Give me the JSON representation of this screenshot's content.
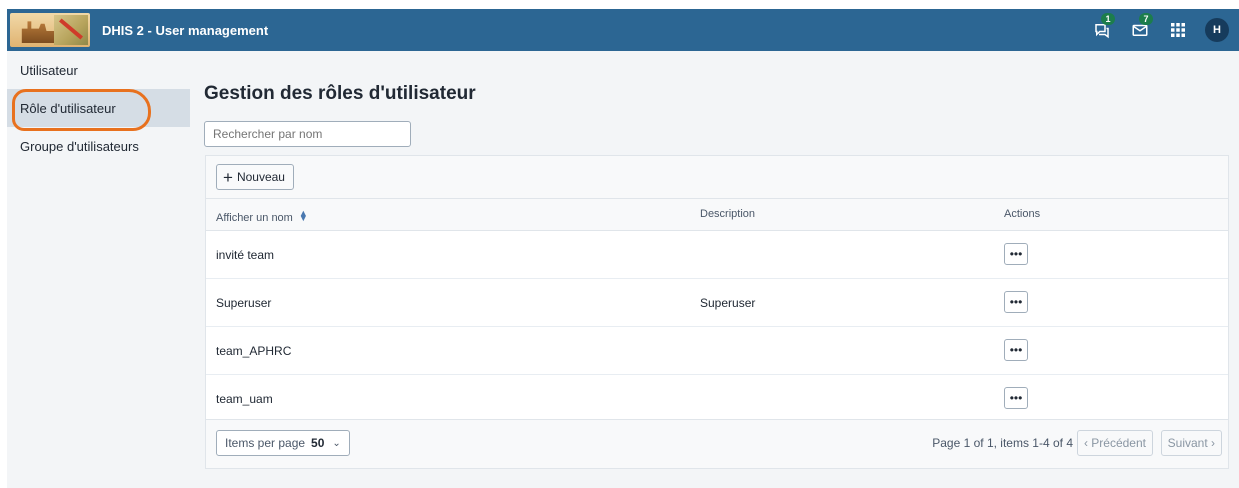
{
  "app": {
    "title": "DHIS 2 - User management"
  },
  "header": {
    "icons": [
      {
        "name": "interpretations-icon",
        "badge": "1"
      },
      {
        "name": "messages-icon",
        "badge": "7"
      },
      {
        "name": "apps-grid-icon"
      }
    ],
    "avatar_initial": "H"
  },
  "sidebar": {
    "items": [
      {
        "label": "Utilisateur",
        "active": false
      },
      {
        "label": "Rôle d'utilisateur",
        "active": true
      },
      {
        "label": "Groupe d'utilisateurs",
        "active": false
      }
    ]
  },
  "main": {
    "title": "Gestion des rôles d'utilisateur",
    "search_placeholder": "Rechercher par nom",
    "new_button": "Nouveau",
    "columns": [
      "Afficher un nom",
      "Description",
      "Actions"
    ],
    "rows": [
      {
        "name": "invité team",
        "description": ""
      },
      {
        "name": "Superuser",
        "description": "Superuser"
      },
      {
        "name": "team_APHRC",
        "description": ""
      },
      {
        "name": "team_uam",
        "description": ""
      }
    ],
    "actions_label": "•••",
    "pagination": {
      "items_per_page_label": "Items per page",
      "items_per_page_value": "50",
      "page_info": "Page 1 of 1, items 1-4 of 4",
      "prev_label": "‹ Précédent",
      "next_label": "Suivant ›"
    }
  },
  "colors": {
    "header": "#2c6693",
    "highlight": "#e8711e",
    "badge": "#1c7d4c"
  }
}
